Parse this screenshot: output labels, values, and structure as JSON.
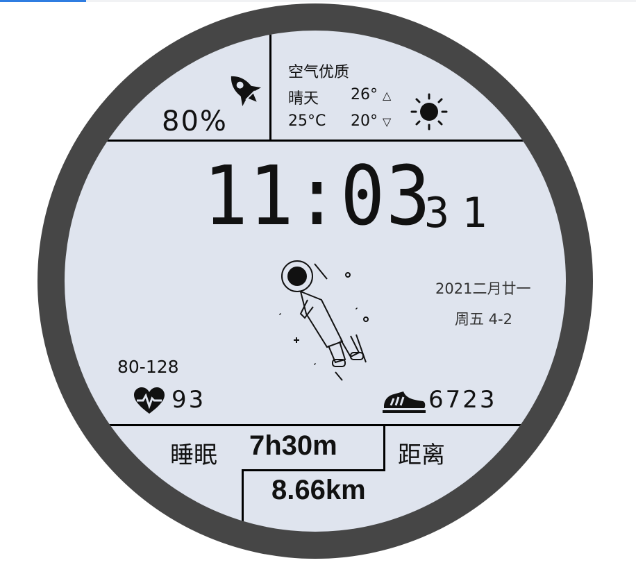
{
  "battery": {
    "percent_label": "80%"
  },
  "weather": {
    "air_quality_label": "空气优质",
    "condition": "晴天",
    "current_temp": "25°C",
    "high_temp": "26°",
    "low_temp": "20°",
    "high_arrow": "△",
    "low_arrow": "▽"
  },
  "time": {
    "hours_minutes": "11:03",
    "seconds": "31"
  },
  "date": {
    "lunar": "2021二月廿一",
    "weekday": "周五 4-2"
  },
  "heart_rate": {
    "range": "80-128",
    "current": "93"
  },
  "steps": {
    "count": "6723"
  },
  "sleep": {
    "label": "睡眠",
    "value": "7h30m"
  },
  "distance": {
    "label": "距离",
    "value": "8.66km"
  },
  "colors": {
    "ring": "#464646",
    "face": "#dfe4ee",
    "ink": "#111111",
    "accent": "#2f7de1"
  },
  "icons": [
    "rocket-icon",
    "sun-icon",
    "astronaut-icon",
    "heart-rate-icon",
    "shoe-icon"
  ]
}
